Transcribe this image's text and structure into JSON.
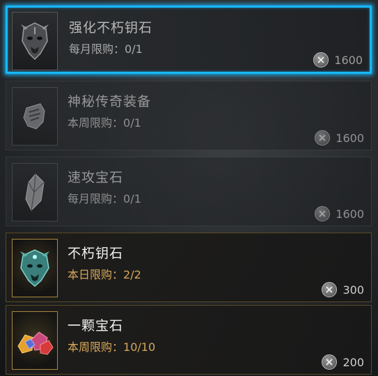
{
  "shop_items": [
    {
      "name": "强化不朽钥石",
      "limit_label": "每月限购：",
      "limit_value": "0/1",
      "price": "1600",
      "icon": "demon-mask-icon",
      "state": "selected"
    },
    {
      "name": "神秘传奇装备",
      "limit_label": "本周限购：",
      "limit_value": "0/1",
      "price": "1600",
      "icon": "gauntlet-icon",
      "state": "sold-out"
    },
    {
      "name": "速攻宝石",
      "limit_label": "每月限购：",
      "limit_value": "0/1",
      "price": "1600",
      "icon": "crystal-gem-icon",
      "state": "sold-out"
    },
    {
      "name": "不朽钥石",
      "limit_label": "本日限购：",
      "limit_value": "2/2",
      "price": "300",
      "icon": "teal-keystone-mask-icon",
      "state": "available"
    },
    {
      "name": "一颗宝石",
      "limit_label": "本周限购：",
      "limit_value": "10/10",
      "price": "200",
      "icon": "colored-gems-icon",
      "state": "available"
    }
  ],
  "currency_icon": "platinum-coin-icon",
  "colors": {
    "selection_glow": "#17b8ff",
    "limit_text_available": "#d6a85a",
    "gold_border": "#a88a3e"
  }
}
